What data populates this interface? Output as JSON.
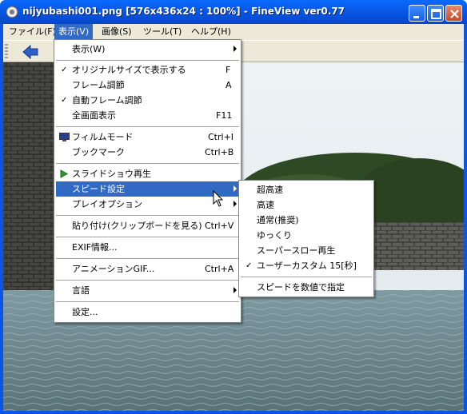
{
  "window": {
    "title": "nijyubashi001.png [576x436x24 : 100%] - FineView ver0.77"
  },
  "menubar": {
    "items": [
      "ファイル(F)",
      "表示(V)",
      "画像(S)",
      "ツール(T)",
      "ヘルプ(H)"
    ],
    "active": "表示(V)"
  },
  "view_menu": {
    "items": [
      {
        "label": "表示(W)",
        "submenu": true
      },
      {
        "label": "オリジナルサイズで表示する",
        "checked": true,
        "shortcut": "F"
      },
      {
        "label": "フレーム調節",
        "shortcut": "A"
      },
      {
        "label": "自動フレーム調節",
        "checked": true
      },
      {
        "label": "全画面表示",
        "shortcut": "F11"
      },
      {
        "label": "フィルムモード",
        "shortcut": "Ctrl+I",
        "icon": "monitor-icon"
      },
      {
        "label": "ブックマーク",
        "shortcut": "Ctrl+B"
      },
      {
        "label": "スライドショウ再生",
        "icon": "play-icon"
      },
      {
        "label": "スピード設定",
        "submenu": true,
        "highlighted": true
      },
      {
        "label": "プレイオプション",
        "submenu": true
      },
      {
        "label": "貼り付け(クリップボードを見る)",
        "shortcut": "Ctrl+V"
      },
      {
        "label": "EXIF情報..."
      },
      {
        "label": "アニメーションGIF...",
        "shortcut": "Ctrl+A"
      },
      {
        "label": "言語",
        "submenu": true
      },
      {
        "label": "設定..."
      }
    ]
  },
  "speed_submenu": {
    "items": [
      {
        "label": "超高速"
      },
      {
        "label": "高速"
      },
      {
        "label": "通常(推奨)"
      },
      {
        "label": "ゆっくり"
      },
      {
        "label": "スーパースロー再生"
      },
      {
        "label": "ユーザーカスタム 15[秒]",
        "checked": true
      },
      {
        "label": "スピードを数値で指定"
      }
    ]
  },
  "check_mark": "✓",
  "colors": {
    "titlebar": "#0a55e6",
    "menu_highlight": "#316ac5",
    "menubar": "#ece9d8"
  }
}
